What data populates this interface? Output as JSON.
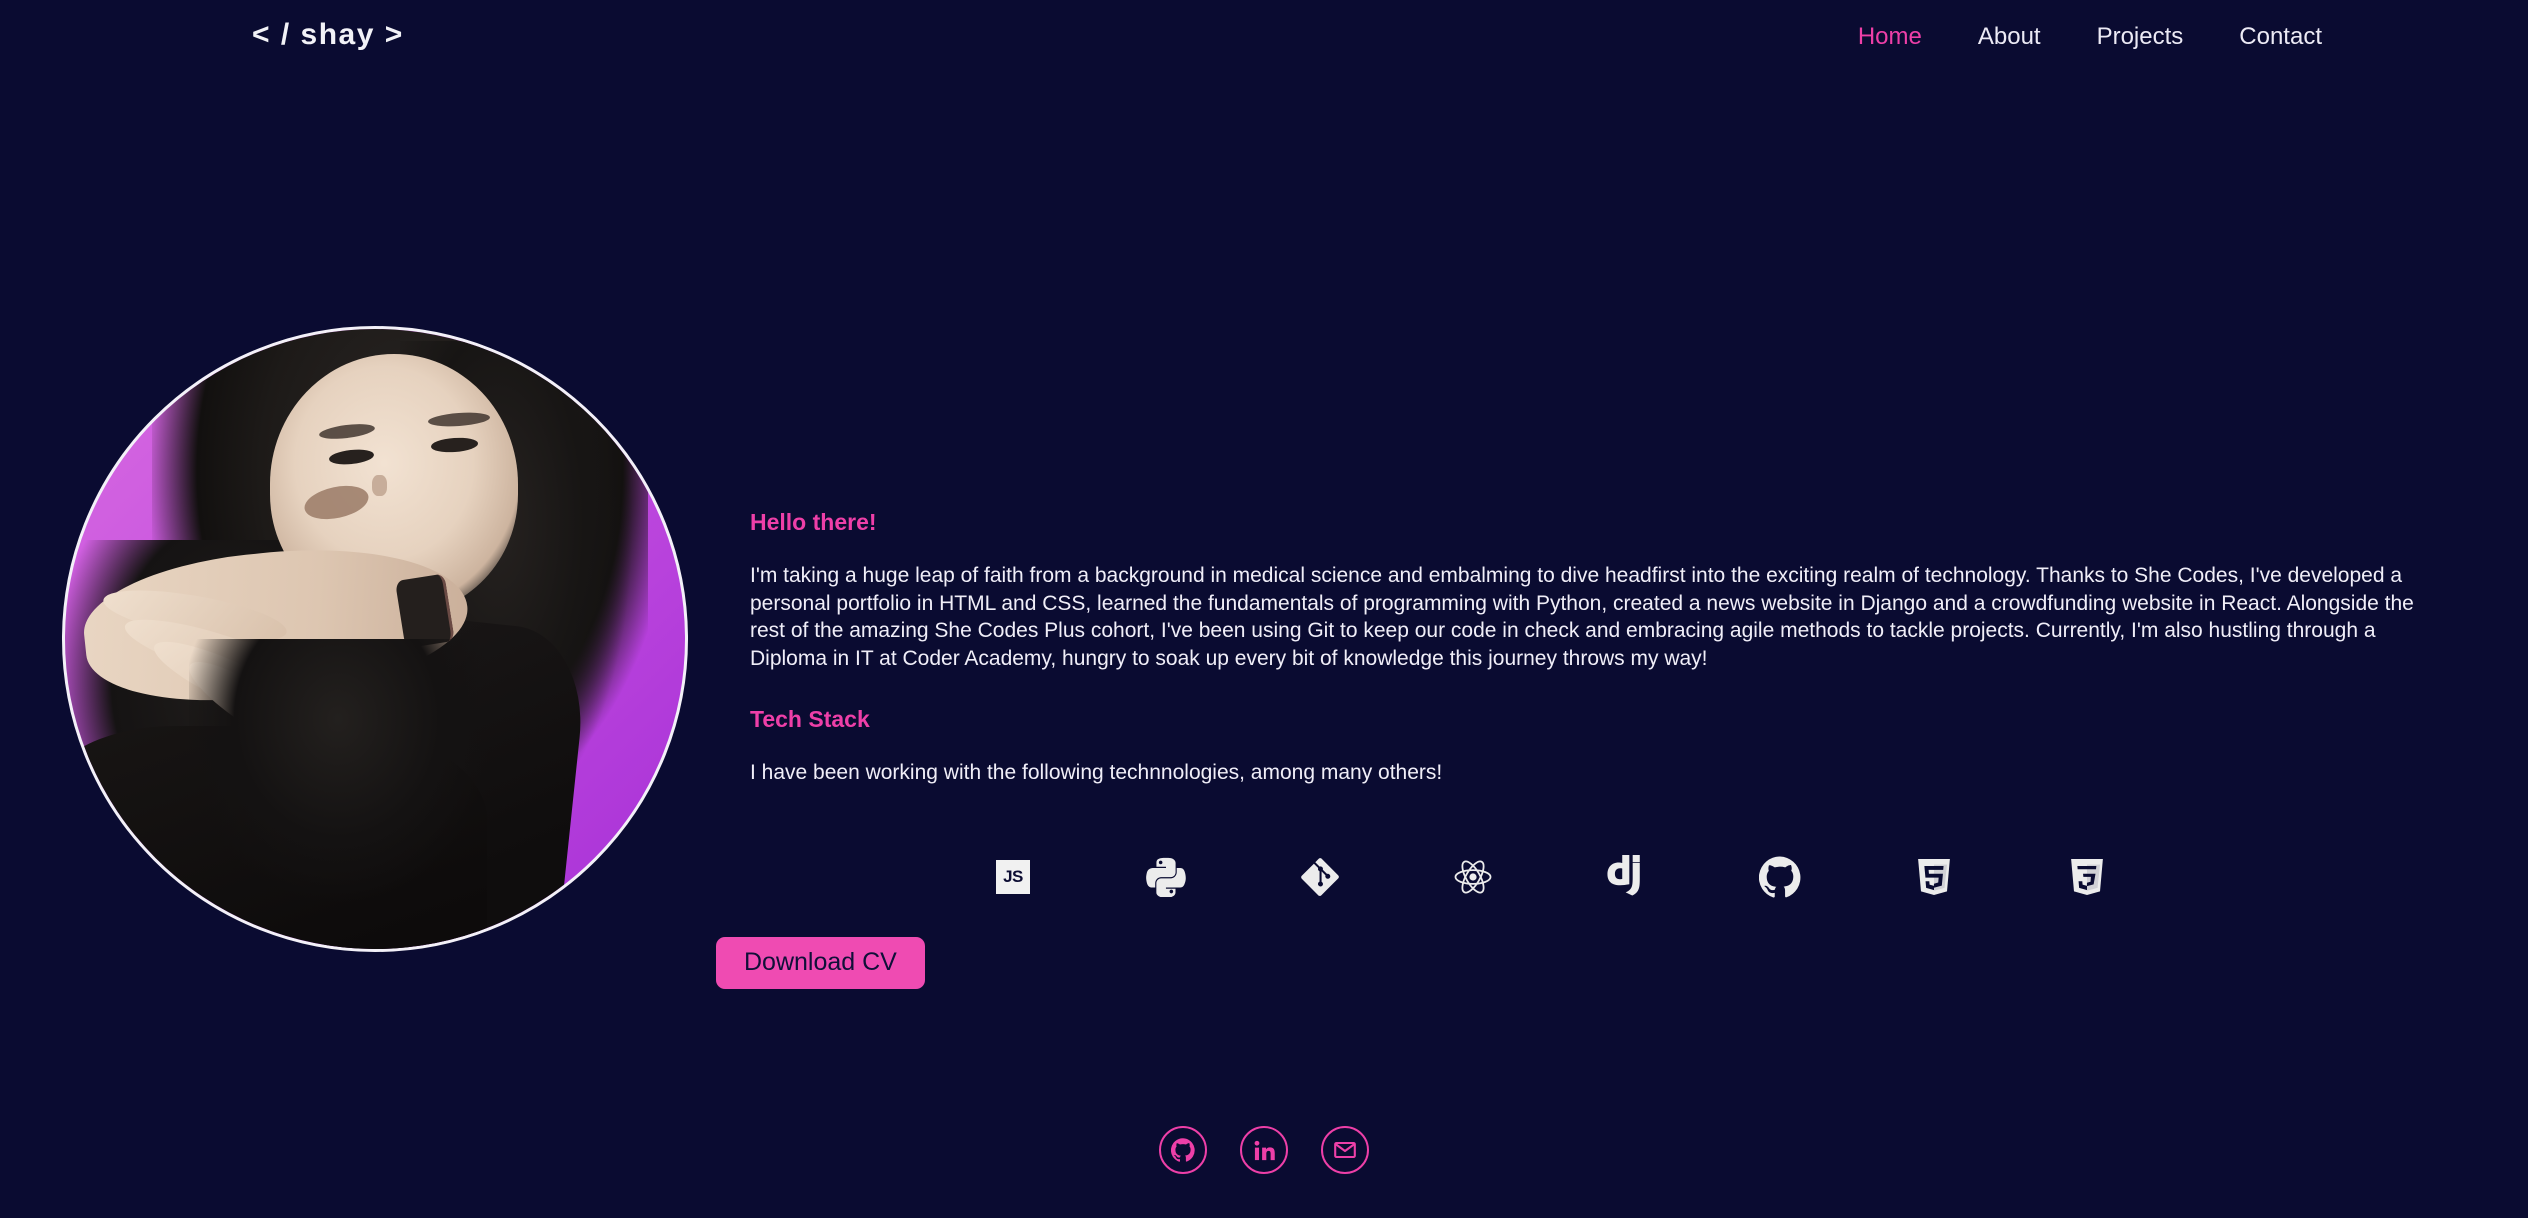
{
  "theme": {
    "background": "#0a0b31",
    "accent_pink": "#ee3fa8",
    "button_pink": "#ef4bb2",
    "text_light": "#f0eef8",
    "avatar_gradient_from": "#d86be0",
    "avatar_gradient_to": "#a62fd6"
  },
  "header": {
    "brand": "< / shay >",
    "nav": [
      {
        "label": "Home",
        "active": true
      },
      {
        "label": "About",
        "active": false
      },
      {
        "label": "Projects",
        "active": false
      },
      {
        "label": "Contact",
        "active": false
      }
    ]
  },
  "hero": {
    "avatar_alt": "profile-photo",
    "greeting": "Hello there!",
    "intro": "I'm taking a huge leap of faith from a background in medical science and embalming to dive headfirst into the exciting realm of technology. Thanks to She Codes, I've developed a personal portfolio in HTML and CSS, learned the fundamentals of programming with Python, created a news website in Django and a crowdfunding website in React. Alongside the rest of the amazing She Codes Plus cohort, I've been using Git to keep our code in check and embracing agile methods to tackle projects. Currently, I'm also hustling through a Diploma in IT at Coder Academy, hungry to soak up every bit of knowledge this journey throws my way!",
    "tech_stack_heading": "Tech Stack",
    "tech_stack_intro": "I have been working with the following technnologies, among many others!",
    "download_cv_label": "Download CV"
  },
  "tech_icons": [
    {
      "name": "javascript-icon",
      "label": "JS"
    },
    {
      "name": "python-icon",
      "label": "Python"
    },
    {
      "name": "git-icon",
      "label": "Git"
    },
    {
      "name": "react-icon",
      "label": "React"
    },
    {
      "name": "django-icon",
      "label": "dj"
    },
    {
      "name": "github-icon",
      "label": "GitHub"
    },
    {
      "name": "html5-icon",
      "label": "HTML5"
    },
    {
      "name": "css3-icon",
      "label": "CSS3"
    }
  ],
  "footer": {
    "socials": [
      {
        "name": "github-social-icon",
        "label": "GitHub"
      },
      {
        "name": "linkedin-social-icon",
        "label": "LinkedIn"
      },
      {
        "name": "email-social-icon",
        "label": "Email"
      }
    ]
  }
}
